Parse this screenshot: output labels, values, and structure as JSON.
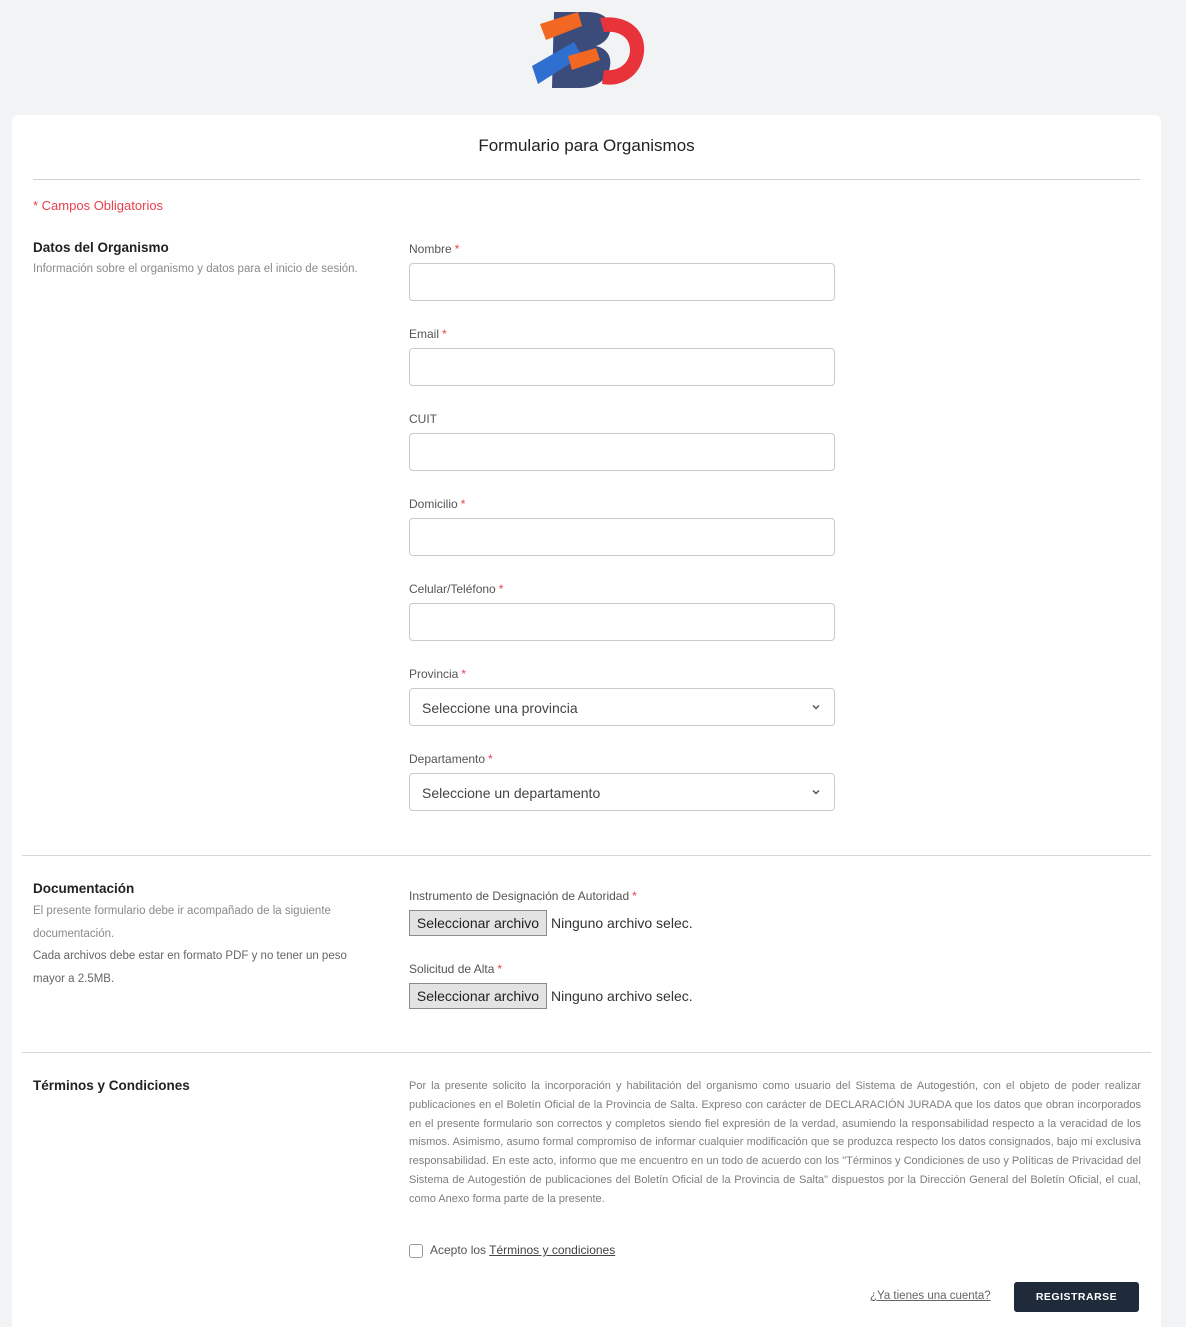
{
  "brand": {
    "logo": "bo-logo",
    "colors": {
      "blue": "#2f6fd0",
      "orange": "#f26722",
      "red": "#e8333a",
      "navy": "#3c4c7a"
    }
  },
  "form": {
    "title": "Formulario para Organismos",
    "required_note": "* Campos Obligatorios",
    "required_marker": "*"
  },
  "organismo": {
    "heading": "Datos del Organismo",
    "description": "Información sobre el organismo y datos para el inicio de sesión.",
    "fields": {
      "nombre": {
        "label": "Nombre",
        "value": ""
      },
      "email": {
        "label": "Email",
        "value": ""
      },
      "cuit": {
        "label": "CUIT",
        "value": ""
      },
      "domicilio": {
        "label": "Domicilio",
        "value": ""
      },
      "telefono": {
        "label": "Celular/Teléfono",
        "value": ""
      },
      "provincia": {
        "label": "Provincia",
        "selected": "Seleccione una provincia"
      },
      "departamento": {
        "label": "Departamento",
        "selected": "Seleccione un departamento"
      }
    }
  },
  "documentacion": {
    "heading": "Documentación",
    "description": "El presente formulario debe ir acompañado de la siguiente documentación.",
    "description_format": "Cada archivos debe estar en formato PDF y no tener un peso mayor a 2.5MB.",
    "files": {
      "instrumento": {
        "label": "Instrumento de Designación de Autoridad",
        "button": "Seleccionar archivo",
        "status": "Ninguno archivo selec."
      },
      "solicitud": {
        "label": "Solicitud de Alta",
        "button": "Seleccionar archivo",
        "status": "Ninguno archivo selec."
      }
    }
  },
  "terminos": {
    "heading": "Términos y Condiciones",
    "text": "Por la presente solicito la incorporación y habilitación del organismo como usuario del Sistema de Autogestión, con el objeto de poder realizar publicaciones en el Boletín Oficial de la Provincia de Salta. Expreso con carácter de DECLARACIÓN JURADA que los datos que obran incorporados en el presente formulario son correctos y completos siendo fiel expresión de la verdad, asumiendo la responsabilidad respecto a la veracidad de los mismos. Asimismo, asumo formal compromiso de informar cualquier modificación que se produzca respecto los datos consignados, bajo mi exclusiva responsabilidad. En este acto, informo que me encuentro en un todo de acuerdo con los \"Términos y Condiciones de uso y Políticas de Privacidad del Sistema de Autogestión de publicaciones del Boletín Oficial de la Provincia de Salta\" dispuestos por la Dirección General del Boletín Oficial, el cual, como Anexo forma parte de la presente.",
    "accept_prefix": "Acepto los ",
    "accept_link": "Términos y condiciones",
    "accepted": false
  },
  "actions": {
    "login_link": "¿Ya tienes una cuenta?",
    "register_button": "REGISTRARSE"
  }
}
